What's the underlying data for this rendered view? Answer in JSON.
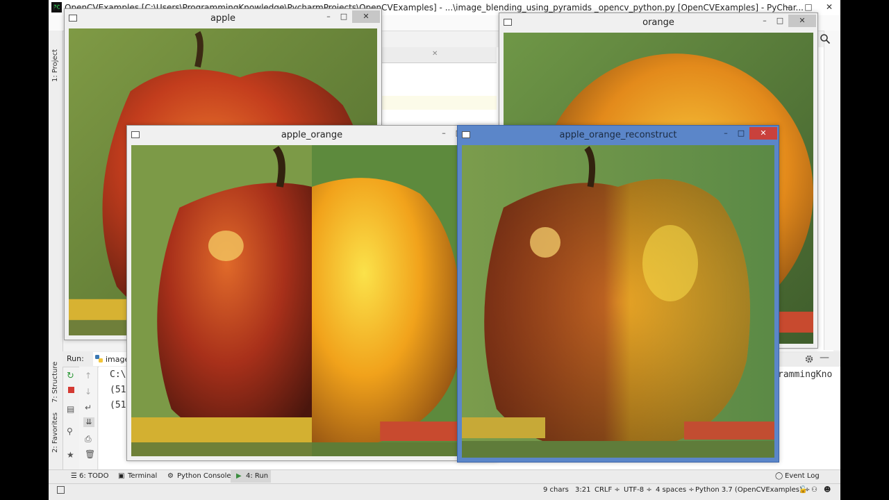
{
  "ide": {
    "title": "OpenCVExamples [C:\\Users\\ProgrammingKnowledge\\PycharmProjects\\OpenCVExamples] - ...\\image_blending_using_pyramids _opencv_python.py [OpenCVExamples] - PyChar...",
    "logo": "PC",
    "menu_file": "Fi",
    "left_tabs": [
      "1: Project",
      "7: Structure",
      "2: Favorites"
    ],
    "run_label": "Run:",
    "run_tab": "image",
    "console_lines": [
      "C:\\",
      "(51",
      "(51"
    ],
    "console_right_fragment_1": ":V",
    "console_right_fragment_2": "rammingKno",
    "editor_fragment": "e [",
    "bottom_tools": [
      "6: TODO",
      "Terminal",
      "Python Console",
      "4: Run",
      "Event Log"
    ],
    "status": [
      "9 chars",
      "3:21",
      "CRLF ÷",
      "UTF-8 ÷",
      "4 spaces ÷",
      "Python 3.7 (OpenCVExamples) ÷"
    ],
    "window_controls": [
      "–",
      "□",
      "✕"
    ]
  },
  "windows": {
    "apple": {
      "title": "apple"
    },
    "orange": {
      "title": "orange"
    },
    "apple_orange": {
      "title": "apple_orange"
    },
    "reconstruct": {
      "title": "apple_orange_reconstruct"
    }
  },
  "colors": {
    "apple_red": "#b8351c",
    "orange_yellow": "#f2a51c",
    "bg_green": "#6f8a3a",
    "active_border": "#5b86c9",
    "close_red": "#c9413c"
  }
}
